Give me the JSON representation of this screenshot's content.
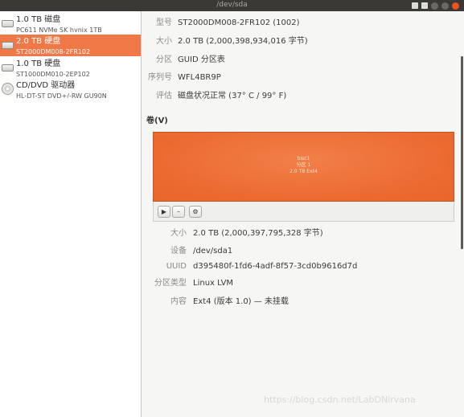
{
  "window": {
    "title": "/dev/sda",
    "accent": "#e95420"
  },
  "sidebar": {
    "drives": [
      {
        "name": "1.0 TB 磁盘",
        "model": "PC611 NVMe SK hynix 1TB",
        "icon": "hdd-icon"
      },
      {
        "name": "2.0 TB 硬盘",
        "model": "ST2000DM008-2FR102",
        "icon": "hdd-icon",
        "selected": true
      },
      {
        "name": "1.0 TB 硬盘",
        "model": "ST1000DM010-2EP102",
        "icon": "hdd-icon"
      },
      {
        "name": "CD/DVD 驱动器",
        "model": "HL-DT-ST DVD+/-RW GU90N",
        "icon": "cd-icon"
      }
    ],
    "selection_color": "#f07746"
  },
  "disk": {
    "model": {
      "label": "型号",
      "value": "ST2000DM008-2FR102 (1002)"
    },
    "size": {
      "label": "大小",
      "value": "2.0 TB (2,000,398,934,016 字节)"
    },
    "partitioning": {
      "label": "分区",
      "value": "GUID 分区表"
    },
    "serial": {
      "label": "序列号",
      "value": "WFL4BR9P"
    },
    "assessment": {
      "label": "评估",
      "value": "磁盘状况正常 (37° C / 99° F)"
    }
  },
  "volumes": {
    "heading": "卷(V)",
    "map": {
      "line1": "bisc1",
      "line2": "分区 1",
      "line3": "2.0 TB Ext4",
      "color": "#ec6e35"
    },
    "toolbar": {
      "play": "▶",
      "minus": "–",
      "settings": "⚙"
    }
  },
  "partition": {
    "size": {
      "label": "大小",
      "value": "2.0 TB (2,000,397,795,328 字节)"
    },
    "device": {
      "label": "设备",
      "value": "/dev/sda1"
    },
    "uuid": {
      "label": "UUID",
      "value": "d395480f-1fd6-4adf-8f57-3cd0b9616d7d"
    },
    "type": {
      "label": "分区类型",
      "value": "Linux LVM"
    },
    "contents": {
      "label": "内容",
      "value": "Ext4 (版本 1.0) — 未挂载"
    }
  },
  "watermark": "https://blog.csdn.net/LabDNirvana"
}
